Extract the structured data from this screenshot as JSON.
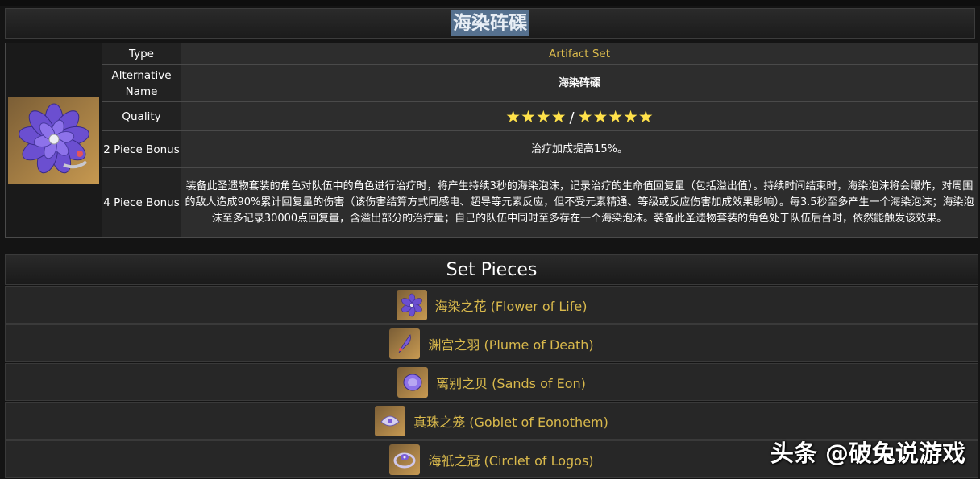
{
  "title": "海染砗磲",
  "info": {
    "type_label": "Type",
    "type_value": "Artifact Set",
    "alt_label": "Alternative Name",
    "alt_value": "海染砗磲",
    "quality_label": "Quality",
    "quality_low": "★★★★",
    "quality_sep": "/",
    "quality_high": "★★★★★",
    "two_piece_label": "2 Piece Bonus",
    "two_piece_value": "治疗加成提高15%。",
    "four_piece_label": "4 Piece Bonus",
    "four_piece_value": "装备此圣遗物套装的角色对队伍中的角色进行治疗时，将产生持续3秒的海染泡沫，记录治疗的生命值回复量（包括溢出值）。持续时间结束时，海染泡沫将会爆炸，对周围的敌人造成90%累计回复量的伤害（该伤害结算方式同感电、超导等元素反应，但不受元素精通、等级或反应伤害加成效果影响）。每3.5秒至多产生一个海染泡沫；海染泡沫至多记录30000点回复量，含溢出部分的治疗量；自己的队伍中同时至多存在一个海染泡沫。装备此圣遗物套装的角色处于队伍后台时，依然能触发该效果。"
  },
  "pieces": {
    "header": "Set Pieces",
    "items": [
      {
        "label": "海染之花 (Flower of Life)",
        "icon": "flower-icon"
      },
      {
        "label": "渊宫之羽 (Plume of Death)",
        "icon": "plume-icon"
      },
      {
        "label": "离别之贝 (Sands of Eon)",
        "icon": "shell-icon"
      },
      {
        "label": "真珠之笼 (Goblet of Eonothem)",
        "icon": "goblet-icon"
      },
      {
        "label": "海祇之冠 (Circlet of Logos)",
        "icon": "circlet-icon"
      }
    ]
  },
  "watermark": "头条 @破兔说游戏",
  "colors": {
    "gold_text": "#d9b94c",
    "star": "#ffe14a",
    "title_highlight": "#56718f",
    "icon_background": "#c79950",
    "flower_purple": "#6b4fd0"
  }
}
